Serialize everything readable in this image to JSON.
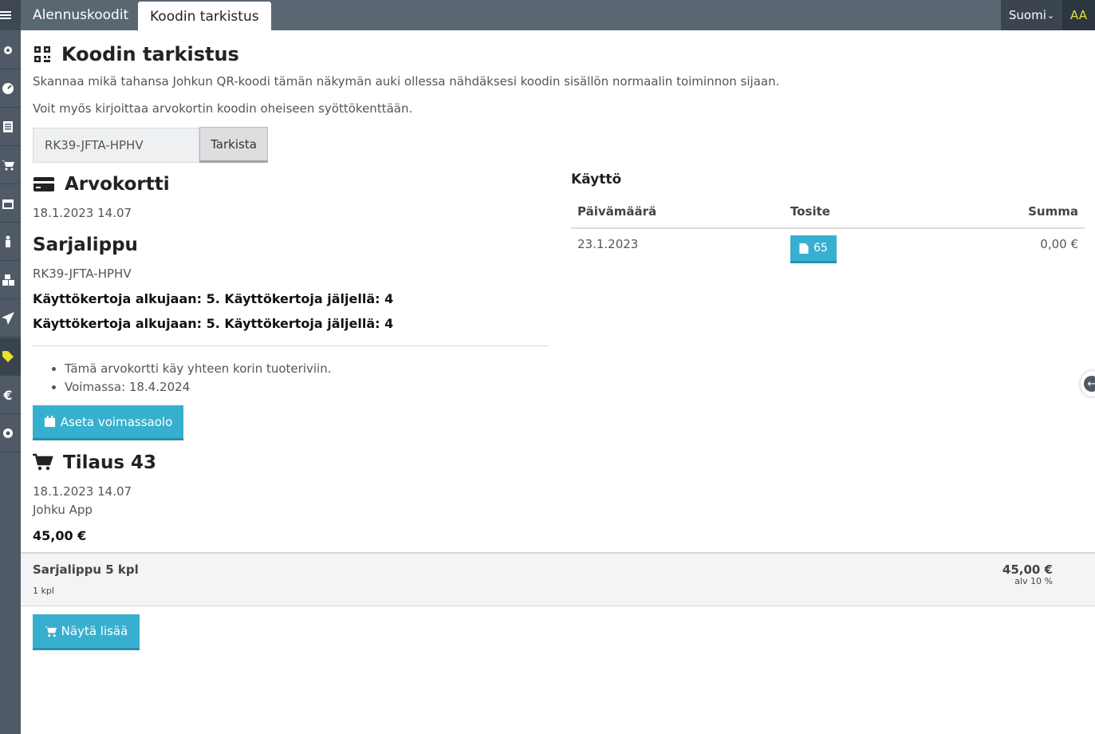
{
  "topbar": {
    "tab_discount_codes": "Alennuskoodit",
    "tab_code_check": "Koodin tarkistus",
    "language": "Suomi",
    "accessibility": "AA"
  },
  "sidebar": {
    "icons": [
      "menu-icon",
      "star-gear-icon",
      "dashboard-icon",
      "document-icon",
      "cart-icon",
      "calendar-icon",
      "person-icon",
      "cubes-icon",
      "send-icon",
      "tag-icon",
      "euro-icon",
      "settings-icon"
    ],
    "active": "tag-icon"
  },
  "page": {
    "title": "Koodin tarkistus",
    "intro": "Skannaa mikä tahansa Johkun QR-koodi tämän näkymän auki ollessa nähdäksesi koodin sisällön normaalin toiminnon sijaan.",
    "intro2": "Voit myös kirjoittaa arvokortin koodin oheiseen syöttökenttään.",
    "code_value": "RK39-JFTA-HPHV",
    "check_button": "Tarkista"
  },
  "card": {
    "heading": "Arvokortti",
    "created": "18.1.2023 14.07",
    "product": "Sarjalippu",
    "code": "RK39-JFTA-HPHV",
    "usage_line_1": "Käyttökertoja alkujaan: 5. Käyttökertoja jäljellä: 4",
    "usage_line_2": "Käyttökertoja alkujaan: 5. Käyttökertoja jäljellä: 4",
    "notes": [
      "Tämä arvokortti käy yhteen korin tuoteriviin.",
      "Voimassa: 18.4.2024"
    ],
    "set_validity_button": "Aseta voimassaolo"
  },
  "order": {
    "heading": "Tilaus 43",
    "created": "18.1.2023 14.07",
    "channel": "Johku App",
    "total": "45,00 €",
    "row_name": "Sarjalippu 5 kpl",
    "row_qty": "1 kpl",
    "row_price": "45,00 €",
    "row_vat": "alv 10 %",
    "show_more_button": "Näytä lisää"
  },
  "usage": {
    "title": "Käyttö",
    "headers": [
      "Päivämäärä",
      "Tosite",
      "Summa"
    ],
    "rows": [
      {
        "date": "23.1.2023",
        "receipt": "65",
        "sum": "0,00 €"
      }
    ]
  },
  "colors": {
    "accent": "#37b0cf",
    "sidebar": "#4f5a66",
    "highlight": "#e8e22a"
  }
}
